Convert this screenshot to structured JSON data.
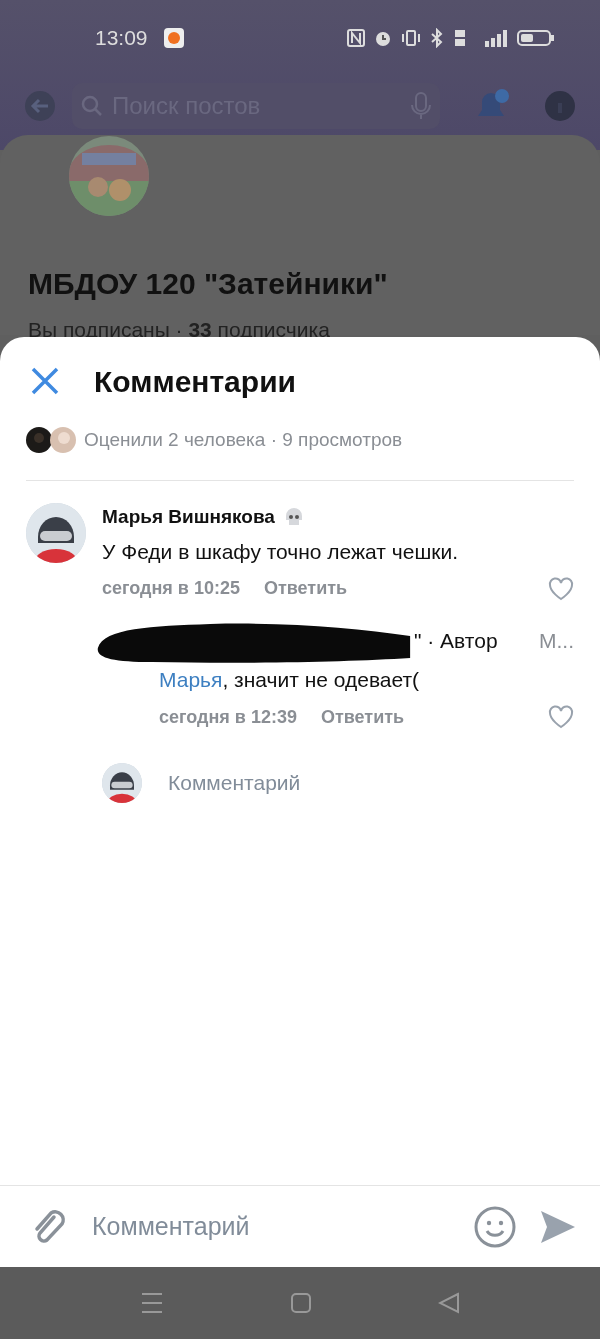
{
  "status_bar": {
    "time": "13:09"
  },
  "background_page": {
    "search": {
      "placeholder": "Поиск постов"
    },
    "group_name": "МБДОУ 120 \"Затейники\"",
    "subscribers": "Вы подписаны · **33** подписчика"
  },
  "sheet": {
    "title": "Комментарии",
    "likes_summary": "Оценили 2 человека · 9 просмотров",
    "comments": [
      {
        "author": "Марья Вишнякова",
        "text": "У Феди в шкафу точно лежат чешки.",
        "time": "сегодня в 10:25",
        "reply_action": "Ответить",
        "liked": false,
        "replies": [
          {
            "author_tail": "\" · Автор",
            "reply_to": "М...",
            "mention": "Марья",
            "text": ", значит не одевает(",
            "time": "сегодня в 12:39",
            "reply_action": "Ответить",
            "liked": false
          }
        ]
      }
    ],
    "reply_input": {
      "placeholder": "Комментарий"
    }
  },
  "composer": {
    "placeholder": "Комментарий"
  }
}
